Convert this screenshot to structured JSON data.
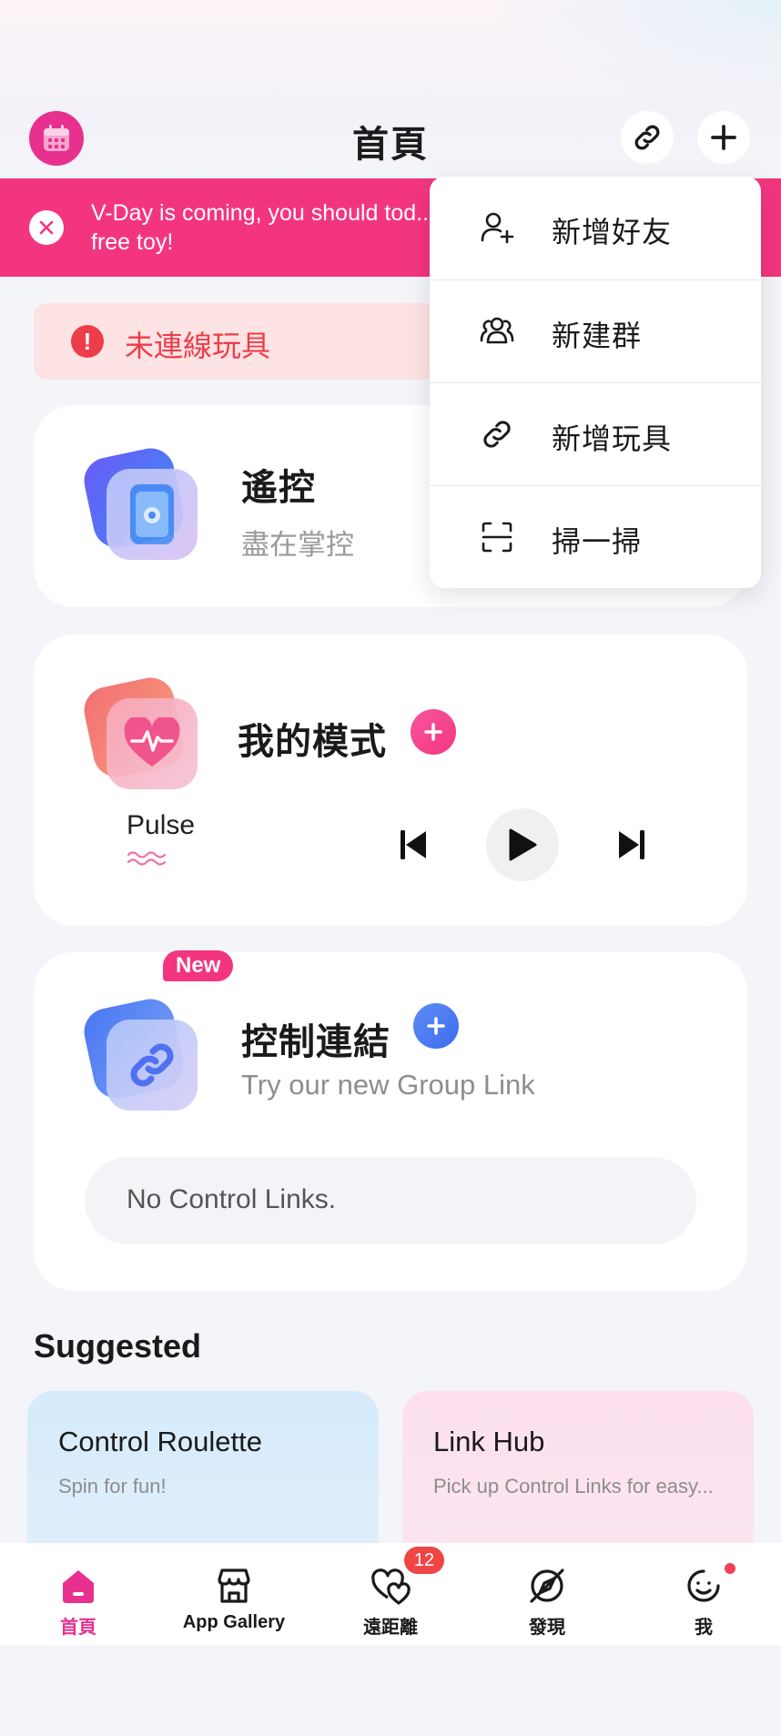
{
  "header": {
    "title": "首頁"
  },
  "banner": {
    "text": "V-Day is coming, you should tod... free toy!"
  },
  "alert": {
    "text": "未連線玩具"
  },
  "remote_card": {
    "title": "遙控",
    "subtitle": "盡在掌控"
  },
  "mode_card": {
    "title": "我的模式",
    "pattern_name": "Pulse"
  },
  "link_card": {
    "badge": "New",
    "title": "控制連結",
    "subtitle": "Try our new Group Link",
    "empty_text": "No Control Links."
  },
  "suggested": {
    "title": "Suggested",
    "items": [
      {
        "title": "Control Roulette",
        "subtitle": "Spin for fun!"
      },
      {
        "title": "Link Hub",
        "subtitle": "Pick up Control Links for easy..."
      }
    ]
  },
  "dropdown": {
    "items": [
      {
        "label": "新增好友",
        "icon": "add-friend-icon"
      },
      {
        "label": "新建群",
        "icon": "group-icon"
      },
      {
        "label": "新增玩具",
        "icon": "link-icon"
      },
      {
        "label": "掃一掃",
        "icon": "scan-icon"
      }
    ]
  },
  "bottom_nav": {
    "items": [
      {
        "label": "首頁",
        "icon": "home-icon",
        "active": true
      },
      {
        "label": "App Gallery",
        "icon": "store-icon"
      },
      {
        "label": "遠距離",
        "icon": "hearts-icon",
        "badge": "12"
      },
      {
        "label": "發現",
        "icon": "discover-icon"
      },
      {
        "label": "我",
        "icon": "profile-icon",
        "dot": true
      }
    ]
  },
  "colors": {
    "brand_pink": "#e8308f",
    "banner_pink": "#f3357f",
    "alert_red": "#ee3d4a",
    "link_blue": "#3d7bf0"
  }
}
